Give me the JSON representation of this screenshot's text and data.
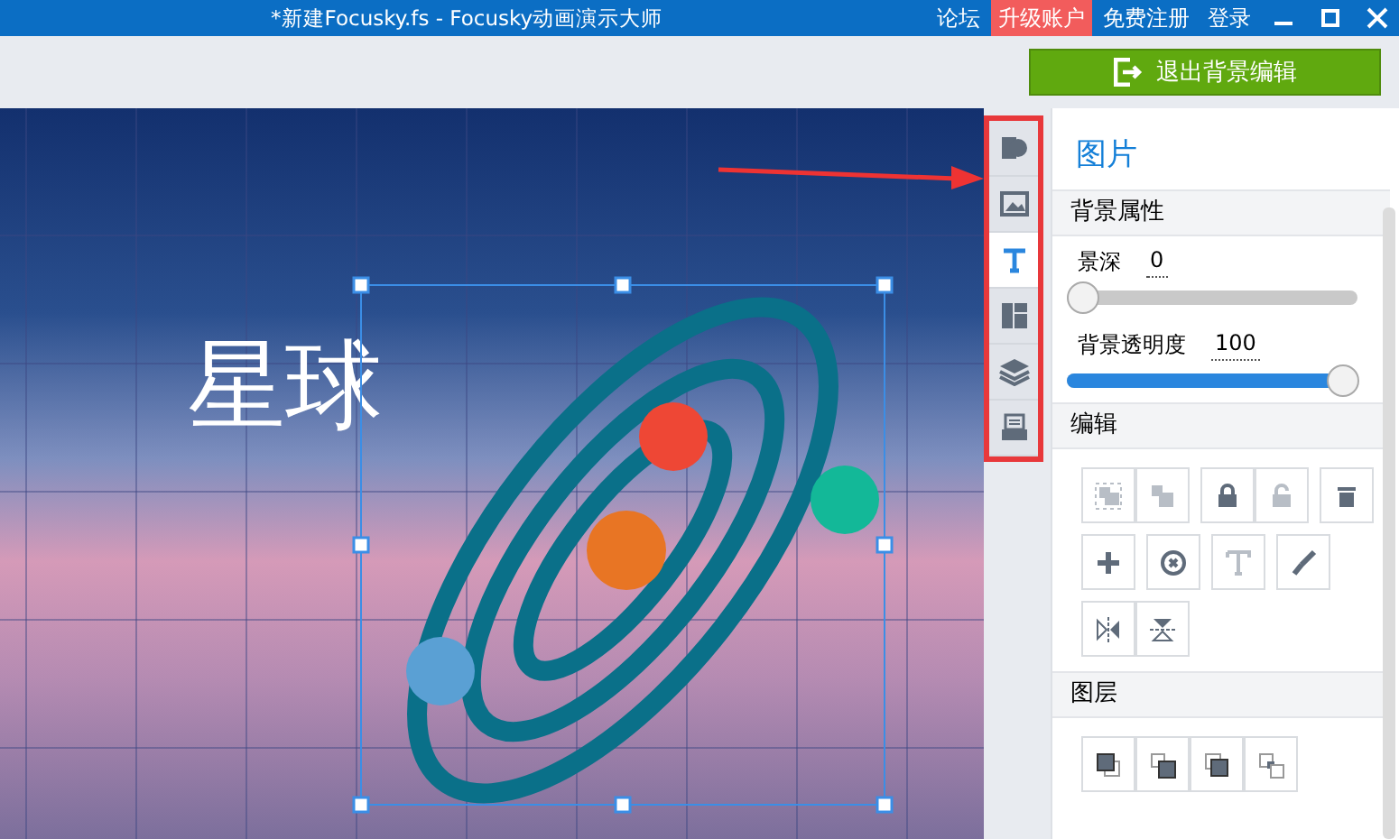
{
  "window": {
    "title": "*新建Focusky.fs - Focusky动画演示大师",
    "links": [
      {
        "label": "论坛",
        "highlighted": false
      },
      {
        "label": "升级账户",
        "highlighted": true
      },
      {
        "label": "免费注册",
        "highlighted": false
      },
      {
        "label": "登录",
        "highlighted": false
      }
    ]
  },
  "toolbar": {
    "exit_button": "退出背景编辑"
  },
  "canvas": {
    "heading": "星球"
  },
  "tool_strip": [
    {
      "kind": "shape",
      "selected": false
    },
    {
      "kind": "image",
      "selected": false
    },
    {
      "kind": "text",
      "selected": true
    },
    {
      "kind": "layout",
      "selected": false
    },
    {
      "kind": "layers",
      "selected": false
    },
    {
      "kind": "tray",
      "selected": false
    }
  ],
  "panel": {
    "title": "图片",
    "section": "背景属性",
    "sliders": [
      {
        "label": "景深",
        "reading": "0",
        "level": 0
      },
      {
        "label": "背景透明度",
        "reading": "100",
        "level": 1
      }
    ],
    "edit": {
      "title": "编辑",
      "rows": [
        [
          [
            {
              "kind": "group",
              "disabled": true
            },
            {
              "kind": "ungroup",
              "disabled": true
            }
          ],
          [
            {
              "kind": "lock",
              "disabled": false
            },
            {
              "kind": "unlock",
              "disabled": true
            }
          ],
          [
            {
              "kind": "delete",
              "disabled": false
            }
          ]
        ],
        [
          [
            {
              "kind": "add",
              "disabled": false
            }
          ],
          [
            {
              "kind": "reset",
              "disabled": false
            }
          ],
          [
            {
              "kind": "text",
              "disabled": true
            }
          ],
          [
            {
              "kind": "brush",
              "disabled": false
            }
          ]
        ],
        [
          [
            {
              "kind": "flip-h",
              "disabled": false
            },
            {
              "kind": "flip-v",
              "disabled": false
            }
          ]
        ]
      ]
    },
    "layers": {
      "title": "图层",
      "buttons": [
        {
          "kind": "top",
          "disabled": false
        },
        {
          "kind": "up",
          "disabled": false
        },
        {
          "kind": "down",
          "disabled": false
        },
        {
          "kind": "bottom",
          "disabled": false
        }
      ]
    }
  }
}
